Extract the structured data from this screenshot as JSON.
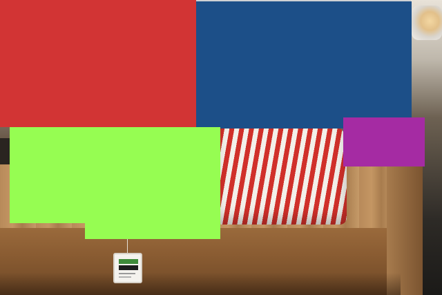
{
  "blocks": [
    {
      "id": "red-block",
      "color": "#d23434"
    },
    {
      "id": "blue-block",
      "color": "#1c4f88"
    },
    {
      "id": "green-block-left",
      "color": "#96fd52"
    },
    {
      "id": "green-block-right",
      "color": "#96fd52"
    },
    {
      "id": "purple-block",
      "color": "#a52ba3"
    }
  ]
}
